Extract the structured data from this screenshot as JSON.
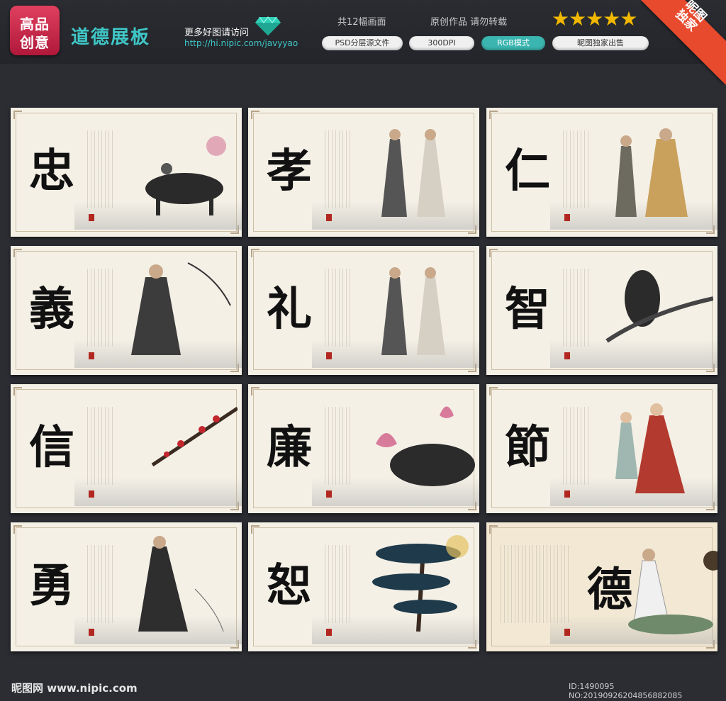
{
  "header": {
    "logo_line1": "高品",
    "logo_line2": "创意",
    "title": "道德展板",
    "more_text": "更多好图请访问",
    "url": "http://hi.nipic.com/javyyao",
    "count_text": "共12幅画面",
    "original_text": "原创作品 请勿转载",
    "stars": "★★★★★",
    "tags": [
      "PSD分层源文件",
      "300DPI",
      "RGB模式",
      "昵图独家出售"
    ],
    "ribbon": "昵图\n独家"
  },
  "panels": [
    {
      "char": "忠",
      "art": "ox-boy-icon"
    },
    {
      "char": "孝",
      "art": "two-scholars-icon"
    },
    {
      "char": "仁",
      "art": "elder-and-sage-icon"
    },
    {
      "char": "義",
      "art": "sage-icon"
    },
    {
      "char": "礼",
      "art": "two-scholars-icon"
    },
    {
      "char": "智",
      "art": "eagle-icon"
    },
    {
      "char": "信",
      "art": "plum-blossom-icon"
    },
    {
      "char": "廉",
      "art": "lotus-icon"
    },
    {
      "char": "節",
      "art": "couple-icon"
    },
    {
      "char": "勇",
      "art": "warrior-icon"
    },
    {
      "char": "恕",
      "art": "pine-tree-icon"
    },
    {
      "char": "德",
      "art": "old-man-ox-icon"
    }
  ],
  "footer": {
    "logo": "昵图网 www.nipic.com",
    "id": "ID:1490095 NO:20190926204856882085"
  },
  "colors": {
    "accent": "#3fc7c7",
    "ribbon": "#e84a2e",
    "star": "#f2b800",
    "seal": "#b2271f"
  }
}
